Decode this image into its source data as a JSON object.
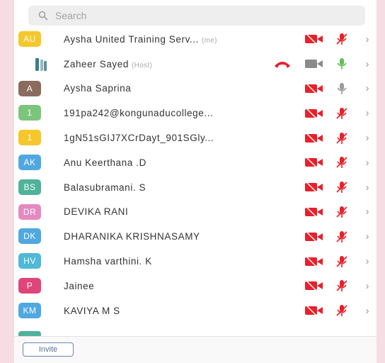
{
  "search": {
    "placeholder": "Search"
  },
  "participants": [
    {
      "initials": "AU",
      "avatar_color": "#f5c72a",
      "name": "Aysha United Training Serv...",
      "tag": "(me)",
      "mic": "muted"
    },
    {
      "initials": "",
      "avatar_color": "",
      "name": "Zaheer Sayed",
      "tag": "(Host)",
      "mic": "on",
      "host": true
    },
    {
      "initials": "A",
      "avatar_color": "#8b6b5e",
      "name": "Aysha Saprina",
      "tag": "",
      "mic": "gray"
    },
    {
      "initials": "1",
      "avatar_color": "#7bc67a",
      "name": "191pa242@kongunaducollege...",
      "tag": "",
      "mic": "muted"
    },
    {
      "initials": "1",
      "avatar_color": "#f5c72a",
      "name": "1gN51sGIJ7XCrDayt_901SGly...",
      "tag": "",
      "mic": "muted"
    },
    {
      "initials": "AK",
      "avatar_color": "#4fa8e0",
      "name": "Anu Keerthana .D",
      "tag": "",
      "mic": "muted"
    },
    {
      "initials": "BS",
      "avatar_color": "#4fb29a",
      "name": "Balasubramani. S",
      "tag": "",
      "mic": "muted"
    },
    {
      "initials": "DR",
      "avatar_color": "#e58ac0",
      "name": "DEVIKA RANI",
      "tag": "",
      "mic": "muted"
    },
    {
      "initials": "DK",
      "avatar_color": "#4fa8e0",
      "name": "DHARANIKA KRISHNASAMY",
      "tag": "",
      "mic": "muted"
    },
    {
      "initials": "HV",
      "avatar_color": "#4fb9d6",
      "name": "Hamsha varthini. K",
      "tag": "",
      "mic": "muted"
    },
    {
      "initials": "P",
      "avatar_color": "#e0457a",
      "name": "Jainee",
      "tag": "",
      "mic": "muted"
    },
    {
      "initials": "KM",
      "avatar_color": "#4fa8e0",
      "name": "KAVIYA M S",
      "tag": "",
      "mic": "muted"
    }
  ],
  "footer": {
    "invite_label": "Invite"
  },
  "colors": {
    "muted_red": "#e8202a",
    "mic_on_green": "#5fbf55",
    "gray": "#9a9a9a"
  }
}
